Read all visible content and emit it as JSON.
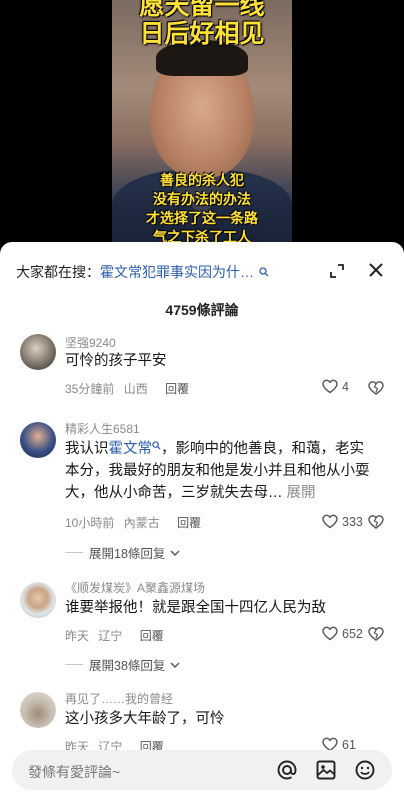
{
  "video": {
    "title_line1": "愿天留一线",
    "title_line2": "日后好相见",
    "subtitles": [
      "善良的杀人犯",
      "没有办法的办法",
      "才选择了这一条路",
      "气之下杀了工人"
    ]
  },
  "sheet": {
    "search_prefix": "大家都在搜：",
    "search_query": "霍文常犯罪事实因为什…",
    "comment_count": "4759條評論",
    "reply_label": "回覆"
  },
  "comments": [
    {
      "author": "坚强9240",
      "text": "可怜的孩子平安",
      "time": "35分鐘前",
      "location": "山西",
      "likes": "4"
    },
    {
      "author": "精彩人生6581",
      "text_before": "我认识",
      "tag": "霍文常",
      "text_after": "，影响中的他善良，和蔼，老实本分，我最好的朋友和他是发小并且和他从小耍大，他从小命苦，三岁就失去母…",
      "more": "展開",
      "time": "10小時前",
      "location": "內蒙古",
      "likes": "333",
      "replies": "展開18條回复"
    },
    {
      "author": "《顺发煤炭》A聚鑫源煤场",
      "text": "谁要举报他！就是跟全国十四亿人民为敌",
      "time": "昨天",
      "location": "辽宁",
      "likes": "652",
      "replies": "展開38條回复"
    },
    {
      "author": "再见了……我的曾经",
      "text": "这小孩多大年龄了，可怜",
      "time": "昨天",
      "location": "辽宁",
      "likes": "61"
    }
  ],
  "input": {
    "placeholder": "發條有愛評論~"
  },
  "colors": {
    "accent_link": "#2d5ea8",
    "subtitle_yellow": "#ffe13a"
  }
}
